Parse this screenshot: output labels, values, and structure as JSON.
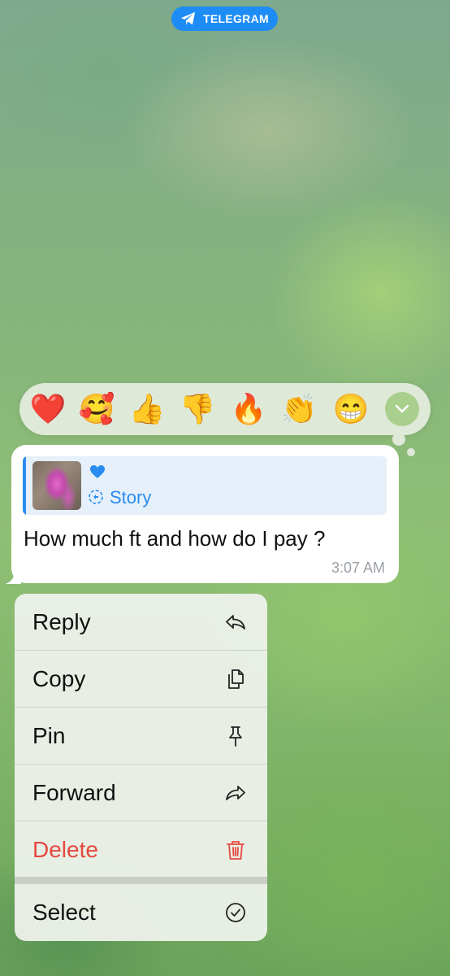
{
  "banner": {
    "label": "TELEGRAM",
    "color": "#1d8cf5"
  },
  "reactions": {
    "items": [
      "❤️",
      "🥰",
      "👍",
      "👎",
      "🔥",
      "👏",
      "😁"
    ],
    "expand_icon": "chevron-down-icon"
  },
  "message": {
    "reply": {
      "reaction": "❤",
      "label": "Story",
      "accent": "#2a8cf0"
    },
    "text": "How much ft and how do I pay ?",
    "time": "3:07 AM"
  },
  "context_menu": {
    "items": [
      {
        "label": "Reply",
        "icon": "reply-icon"
      },
      {
        "label": "Copy",
        "icon": "copy-icon"
      },
      {
        "label": "Pin",
        "icon": "pin-icon"
      },
      {
        "label": "Forward",
        "icon": "forward-icon"
      },
      {
        "label": "Delete",
        "icon": "trash-icon",
        "color": "#e5483f"
      },
      {
        "label": "Select",
        "icon": "check-circle-icon"
      }
    ]
  }
}
